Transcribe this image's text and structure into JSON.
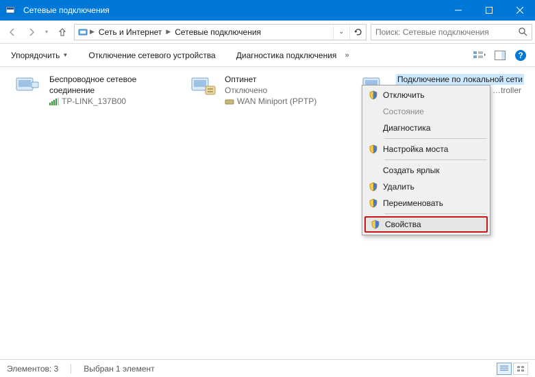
{
  "window": {
    "title": "Сетевые подключения"
  },
  "breadcrumb": {
    "root": "Сеть и Интернет",
    "current": "Сетевые подключения"
  },
  "search": {
    "placeholder": "Поиск: Сетевые подключения"
  },
  "toolbar": {
    "organize": "Упорядочить",
    "disable": "Отключение сетевого устройства",
    "diagnose": "Диагностика подключения"
  },
  "connections": [
    {
      "name": "Беспроводное сетевое соединение",
      "status": "",
      "device": "TP-LINK_137B00"
    },
    {
      "name": "Оптинет",
      "status": "Отключено",
      "device": "WAN Miniport (PPTP)"
    },
    {
      "name": "Подключение по локальной сети",
      "status": "",
      "device": "…troller"
    }
  ],
  "context_menu": {
    "items": [
      {
        "label": "Отключить",
        "shield": true,
        "enabled": true
      },
      {
        "label": "Состояние",
        "shield": false,
        "enabled": false
      },
      {
        "label": "Диагностика",
        "shield": false,
        "enabled": true
      },
      {
        "label": "Настройка моста",
        "shield": true,
        "enabled": true
      },
      {
        "label": "Создать ярлык",
        "shield": false,
        "enabled": true
      },
      {
        "label": "Удалить",
        "shield": true,
        "enabled": true
      },
      {
        "label": "Переименовать",
        "shield": true,
        "enabled": true
      },
      {
        "label": "Свойства",
        "shield": true,
        "enabled": true
      }
    ]
  },
  "statusbar": {
    "count": "Элементов: 3",
    "selected": "Выбран 1 элемент"
  }
}
